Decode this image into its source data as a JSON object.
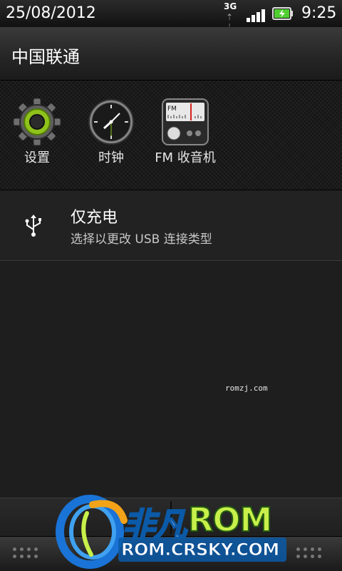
{
  "status_bar": {
    "date": "25/08/2012",
    "network": "3G",
    "time": "9:25",
    "battery_icon": "battery-charging-icon",
    "signal_icon": "signal-strength-icon"
  },
  "carrier": {
    "name": "中国联通"
  },
  "quick_launch": {
    "items": [
      {
        "label": "设置",
        "icon": "settings-gear-icon"
      },
      {
        "label": "时钟",
        "icon": "clock-icon"
      },
      {
        "label": "FM 收音机",
        "icon": "fm-radio-icon"
      }
    ]
  },
  "notification": {
    "icon": "usb-icon",
    "title": "仅充电",
    "subtitle": "选择以更改 USB 连接类型"
  },
  "watermark": {
    "small_text": "romzj.com",
    "logo_text": "非凡",
    "logo_rom": "ROM",
    "logo_url": "ROM.CRSKY.COM"
  },
  "colors": {
    "background": "#1e1e1e",
    "battery_green": "#4fcf2f",
    "gear_green": "#8fc21b",
    "logo_blue": "#1a73d6",
    "logo_green": "#c8f04a"
  }
}
